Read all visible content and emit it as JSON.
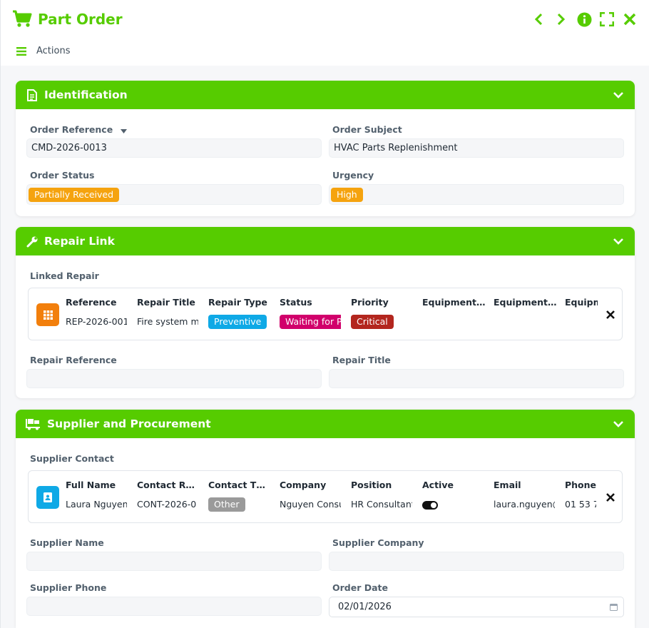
{
  "header": {
    "title": "Part Order",
    "actions_label": "Actions",
    "accent": "#56cc00"
  },
  "identification": {
    "title": "Identification",
    "order_reference_label": "Order Reference",
    "order_reference_value": "CMD-2026-0013",
    "order_subject_label": "Order Subject",
    "order_subject_value": "HVAC Parts Replenishment",
    "order_status_label": "Order Status",
    "order_status_value": "Partially Received",
    "urgency_label": "Urgency",
    "urgency_value": "High"
  },
  "repair_link": {
    "title": "Repair Link",
    "linked_repair_label": "Linked Repair",
    "columns": [
      "Reference",
      "Repair Title",
      "Repair Type",
      "Status",
      "Priority",
      "Equipment…",
      "Equipment…",
      "Equipm"
    ],
    "row": {
      "reference": "REP-2026-001",
      "repair_title": "Fire system m",
      "repair_type": "Preventive",
      "status": "Waiting for P",
      "priority": "Critical"
    },
    "repair_reference_label": "Repair Reference",
    "repair_title_label": "Repair Title"
  },
  "supplier": {
    "title": "Supplier and Procurement",
    "supplier_contact_label": "Supplier Contact",
    "columns": [
      "Full Name",
      "Contact R…",
      "Contact T…",
      "Company",
      "Position",
      "Active",
      "Email",
      "Phone"
    ],
    "row": {
      "full_name": "Laura Nguyen",
      "contact_ref": "CONT-2026-0",
      "contact_type": "Other",
      "company": "Nguyen Consu",
      "position": "HR Consultant",
      "email": "laura.nguyen@",
      "phone": "01 53 7"
    },
    "supplier_name_label": "Supplier Name",
    "supplier_company_label": "Supplier Company",
    "supplier_phone_label": "Supplier Phone",
    "order_date_label": "Order Date",
    "order_date_value": "02/01/2026"
  },
  "colors": {
    "orange": "#f5a30f",
    "blue": "#0fa9e6",
    "magenta": "#d1006b",
    "red": "#b3261e",
    "gray": "#9a9a9a",
    "repair_icon_bg": "#f27f0c"
  }
}
